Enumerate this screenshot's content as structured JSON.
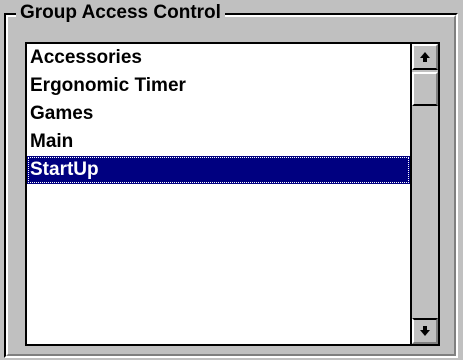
{
  "group": {
    "title": "Group Access Control"
  },
  "listbox": {
    "items": [
      {
        "label": "Accessories",
        "selected": false
      },
      {
        "label": "Ergonomic Timer",
        "selected": false
      },
      {
        "label": "Games",
        "selected": false
      },
      {
        "label": "Main",
        "selected": false
      },
      {
        "label": "StartUp",
        "selected": true
      }
    ],
    "selected_index": 4
  },
  "scrollbar": {
    "up_icon": "arrow-up-icon",
    "down_icon": "arrow-down-icon",
    "thumb_position": 0
  },
  "colors": {
    "face": "#c0c0c0",
    "selection": "#000080",
    "selection_text": "#ffffff",
    "text": "#000000",
    "list_background": "#ffffff"
  }
}
